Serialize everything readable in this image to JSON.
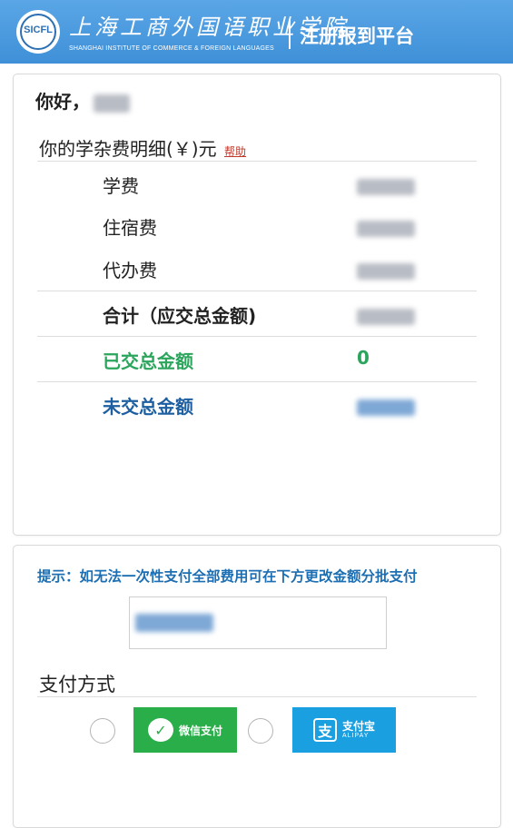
{
  "header": {
    "school_name_cn": "上海工商外国语职业学院",
    "school_name_en": "SHANGHAI INSTITUTE OF COMMERCE & FOREIGN LANGUAGES",
    "logo_text": "SICFL",
    "platform_title": "注册报到平台",
    "header_color": "#4a9be0"
  },
  "summary": {
    "greeting": "你好，",
    "fee_title": "你的学杂费明细(￥)元",
    "help_link": "帮助",
    "items": [
      {
        "label": "学费"
      },
      {
        "label": "住宿费"
      },
      {
        "label": "代办费"
      }
    ],
    "total_label": "合计（应交总金额)",
    "paid_label": "已交总金额",
    "paid_value": "0",
    "unpaid_label": "未交总金额",
    "colors": {
      "paid": "#2ca55c",
      "unpaid": "#1d5fa0"
    }
  },
  "payment": {
    "tip": "提示：如无法一次性支付全部费用可在下方更改金额分批支付",
    "method_title": "支付方式",
    "wechat_label": "微信支付",
    "alipay_label": "支付宝",
    "alipay_sub": "ALIPAY",
    "wechat_color": "#2aae4a",
    "alipay_color": "#1a9fe0",
    "wechat_icon": "wechat-icon",
    "alipay_icon": "alipay-icon"
  }
}
